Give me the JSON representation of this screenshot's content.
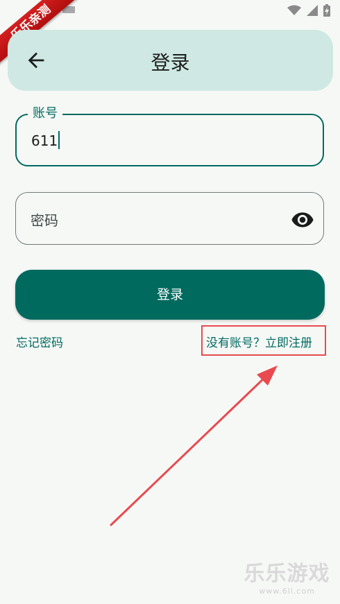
{
  "ribbon": {
    "text": "乐乐亲测"
  },
  "appbar": {
    "title": "登录"
  },
  "account": {
    "label": "账号",
    "value": "611"
  },
  "password": {
    "placeholder": "密码"
  },
  "login_button": {
    "label": "登录"
  },
  "links": {
    "forgot": "忘记密码",
    "register": "没有账号？立即注册"
  },
  "watermark": {
    "brand": "乐乐游戏",
    "url": "www.6ll.com"
  },
  "colors": {
    "primary": "#006a5f",
    "appbar": "#cfe8e3",
    "annotation": "#e84a4f",
    "background": "#f6f8f6"
  },
  "icons": {
    "back": "arrow-left-icon",
    "visibility": "eye-icon",
    "wifi": "wifi-icon",
    "signal": "signal-icon",
    "battery": "battery-icon"
  }
}
